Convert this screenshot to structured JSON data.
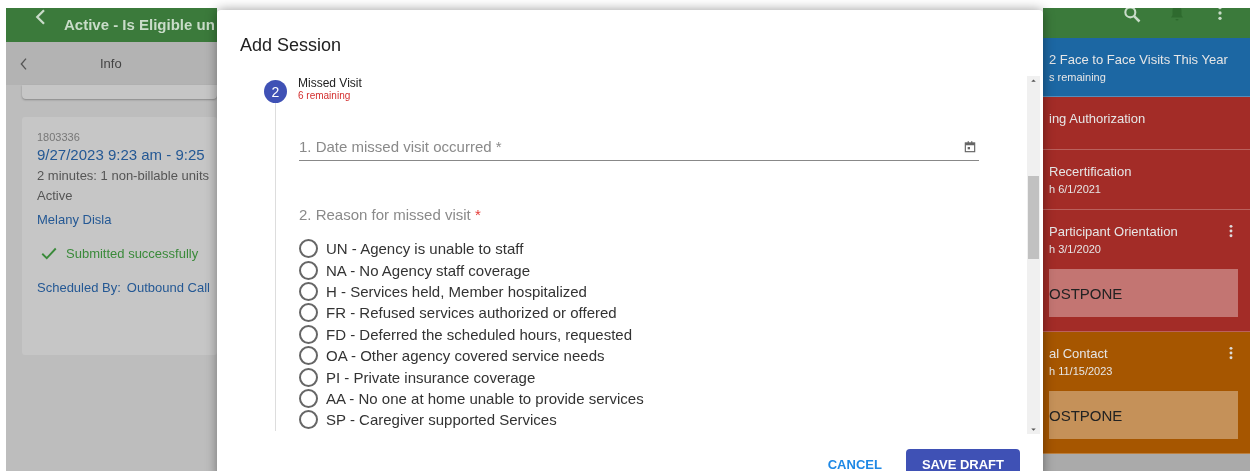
{
  "app_bar": {
    "title": "Active - Is Eligible un"
  },
  "info_panel": {
    "title": "Info",
    "card": {
      "id": "1803336",
      "time": "9/27/2023 9:23 am - 9:25",
      "duration": "2 minutes: 1 non-billable units",
      "status": "Active",
      "person": "Melany Disla",
      "message": "Submitted successfully",
      "scheduled_label": "Scheduled By:",
      "scheduled_value": "Outbound Call"
    }
  },
  "dialog": {
    "title": "Add Session",
    "step": {
      "number": "2",
      "title": "Missed Visit",
      "subtitle": "6 remaining",
      "date_field": {
        "placeholder": "1. Date missed visit occurred *"
      },
      "question": "2. Reason for missed visit",
      "required_mark": "*",
      "options": [
        {
          "label": "UN - Agency is unable to staff",
          "selected": false
        },
        {
          "label": "NA - No Agency staff coverage",
          "selected": false
        },
        {
          "label": "H - Services held, Member hospitalized",
          "selected": false
        },
        {
          "label": "FR - Refused services authorized or offered",
          "selected": false
        },
        {
          "label": "FD - Deferred the scheduled hours, requested",
          "selected": false
        },
        {
          "label": "OA - Other agency covered service needs",
          "selected": false
        },
        {
          "label": "PI - Private insurance coverage",
          "selected": false
        },
        {
          "label": "AA - No one at home unable to provide services",
          "selected": false
        },
        {
          "label": "SP - Caregiver supported Services",
          "selected": false
        }
      ]
    },
    "buttons": [
      {
        "label": "CANCEL",
        "kind": "text"
      },
      {
        "label": "SAVE DRAFT",
        "kind": "primary"
      }
    ]
  },
  "side_cards": [
    {
      "title": "2 Face to Face Visits This Year",
      "subtitle": "s remaining",
      "color": "#1c67a3",
      "menu": false
    },
    {
      "title": "ing Authorization",
      "color": "#a32c27",
      "menu": false
    },
    {
      "title": "Recertification",
      "subtitle": "h 6/1/2021",
      "color": "#a32c27",
      "menu": false
    },
    {
      "title": "Participant Orientation",
      "subtitle": "h 3/1/2020",
      "color": "#a32c27",
      "menu": true,
      "button": "OSTPONE"
    },
    {
      "title": "al Contact",
      "subtitle": "h 11/15/2023",
      "color": "#a65600",
      "menu": true,
      "button": "OSTPONE"
    }
  ]
}
